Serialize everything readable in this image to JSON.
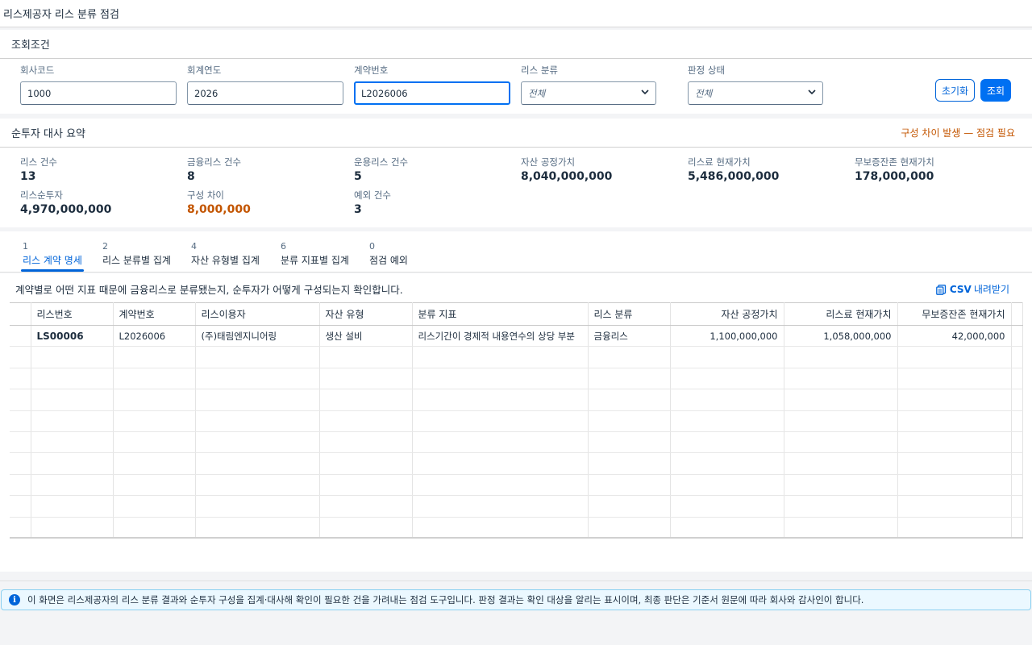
{
  "app": {
    "title": "리스제공자 리스 분류 점검"
  },
  "filter": {
    "title": "조회조건",
    "company_code": {
      "label": "회사코드",
      "value": "1000"
    },
    "fiscal_year": {
      "label": "회계연도",
      "value": "2026"
    },
    "contract_no": {
      "label": "계약번호",
      "value": "L2026006"
    },
    "lease_class": {
      "label": "리스 분류",
      "value": "전체"
    },
    "judge_status": {
      "label": "판정 상태",
      "value": "전체"
    },
    "reset_label": "초기화",
    "search_label": "조회"
  },
  "summary": {
    "title": "순투자 대사 요약",
    "warning": "구성 차이 발생 — 점검 필요",
    "kpis": [
      {
        "label": "리스 건수",
        "value": "13"
      },
      {
        "label": "금융리스 건수",
        "value": "8"
      },
      {
        "label": "운용리스 건수",
        "value": "5"
      },
      {
        "label": "자산 공정가치",
        "value": "8,040,000,000"
      },
      {
        "label": "리스료 현재가치",
        "value": "5,486,000,000"
      },
      {
        "label": "무보증잔존 현재가치",
        "value": "178,000,000"
      },
      {
        "label": "리스순투자",
        "value": "4,970,000,000"
      },
      {
        "label": "구성 차이",
        "value": "8,000,000"
      },
      {
        "label": "예외 건수",
        "value": "3"
      }
    ]
  },
  "tabs": [
    {
      "count": "1",
      "label": "리스 계약 명세"
    },
    {
      "count": "2",
      "label": "리스 분류별 집계"
    },
    {
      "count": "4",
      "label": "자산 유형별 집계"
    },
    {
      "count": "6",
      "label": "분류 지표별 집계"
    },
    {
      "count": "0",
      "label": "점검 예외"
    }
  ],
  "content": {
    "intro": "계약별로 어떤 지표 때문에 금융리스로 분류됐는지, 순투자가 어떻게 구성되는지 확인합니다.",
    "csv_label": "CSV",
    "csv_suffix": "내려받기"
  },
  "table": {
    "headers": [
      "리스번호",
      "계약번호",
      "리스이용자",
      "자산 유형",
      "분류 지표",
      "리스 분류",
      "자산 공정가치",
      "리스료 현재가치",
      "무보증잔존 현재가치"
    ],
    "row": [
      "LS00006",
      "L2026006",
      "(주)태림엔지니어링",
      "생산 설비",
      "리스기간이 경제적 내용연수의 상당 부분",
      "금융리스",
      "1,100,000,000",
      "1,058,000,000",
      "42,000,000"
    ]
  },
  "footer": {
    "message": "이 화면은 리스제공자의 리스 분류 결과와 순투자 구성을 집계·대사해 확인이 필요한 건을 가려내는 점검 도구입니다. 판정 결과는 확인 대상을 알리는 표시이며, 최종 판단은 기준서 원문에 따라 회사와 감사인이 합니다."
  },
  "colors": {
    "accent": "#0070f2",
    "warning": "#c35500",
    "info_bg": "#ebf8ff"
  },
  "icons": [
    "chevron-down-icon",
    "csv-export-icon",
    "info-icon"
  ]
}
